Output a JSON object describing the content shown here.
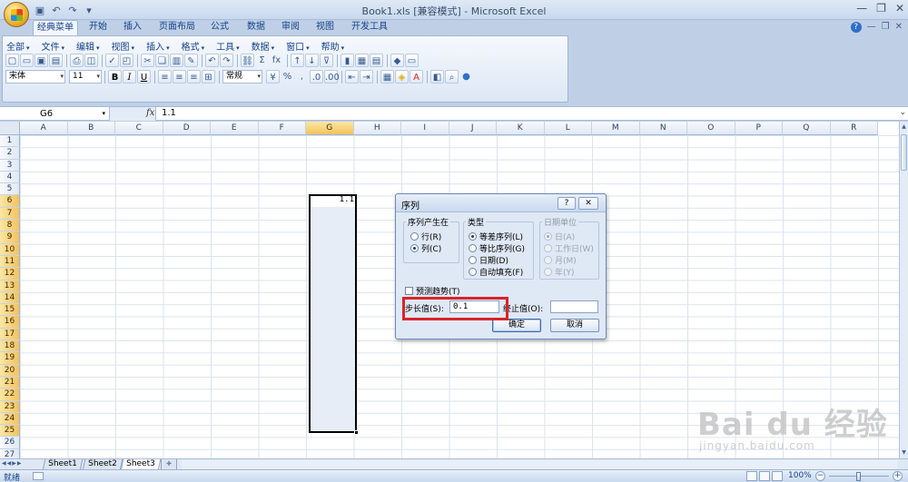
{
  "window": {
    "title": "Book1.xls  [兼容模式] - Microsoft Excel",
    "qat_icons": [
      "save-icon",
      "undo-icon",
      "redo-icon",
      "customize-icon"
    ]
  },
  "ribbon_tabs": [
    "经典菜单",
    "开始",
    "插入",
    "页面布局",
    "公式",
    "数据",
    "审阅",
    "视图",
    "开发工具"
  ],
  "classic_menu": [
    "全部",
    "文件",
    "编辑",
    "视图",
    "插入",
    "格式",
    "工具",
    "数据",
    "窗口",
    "帮助"
  ],
  "toolbar": {
    "font_name": "宋体",
    "font_size": "11",
    "bold_label": "B",
    "italic_label": "I",
    "underline_label": "U",
    "number_format": "常规",
    "percent_label": "%",
    "comma_label": ",",
    "sum_label": "Σ",
    "fx_label": "fx"
  },
  "formula_bar": {
    "name_box": "G6",
    "fx_symbol": "fx",
    "value": "1.1"
  },
  "grid": {
    "columns": [
      "A",
      "B",
      "C",
      "D",
      "E",
      "F",
      "G",
      "H",
      "I",
      "J",
      "K",
      "L",
      "M",
      "N",
      "O",
      "P",
      "Q",
      "R"
    ],
    "selected_column": "G",
    "rows": [
      "1",
      "2",
      "3",
      "4",
      "5",
      "6",
      "7",
      "8",
      "9",
      "10",
      "11",
      "12",
      "13",
      "14",
      "15",
      "16",
      "17",
      "18",
      "19",
      "20",
      "21",
      "22",
      "23",
      "24",
      "25",
      "26",
      "27"
    ],
    "selected_rows_from": 6,
    "selected_rows_to": 25,
    "cell_g6": "1.1"
  },
  "sheets": [
    "Sheet1",
    "Sheet2",
    "Sheet3"
  ],
  "active_sheet": "Sheet3",
  "status_bar": {
    "status": "就绪",
    "zoom": "100%",
    "zoom_minus": "−",
    "zoom_plus": "+"
  },
  "dialog": {
    "title": "序列",
    "help_label": "?",
    "close_label": "✕",
    "series_in": {
      "legend": "序列产生在",
      "options": [
        "行(R)",
        "列(C)"
      ],
      "selected": 1
    },
    "type": {
      "legend": "类型",
      "options": [
        "等差序列(L)",
        "等比序列(G)",
        "日期(D)",
        "自动填充(F)"
      ],
      "selected": 0
    },
    "date_unit": {
      "legend": "日期单位",
      "options": [
        "日(A)",
        "工作日(W)",
        "月(M)",
        "年(Y)"
      ],
      "selected": 0
    },
    "trend_label": "预测趋势(T)",
    "step_label": "步长值(S):",
    "step_value": "0.1",
    "stop_label": "终止值(O):",
    "stop_value": "",
    "ok_label": "确定",
    "cancel_label": "取消",
    "highlight_color": "#d9232a"
  },
  "watermark": {
    "main": "Bai du 经验",
    "url": "jingyan.baidu.com"
  }
}
